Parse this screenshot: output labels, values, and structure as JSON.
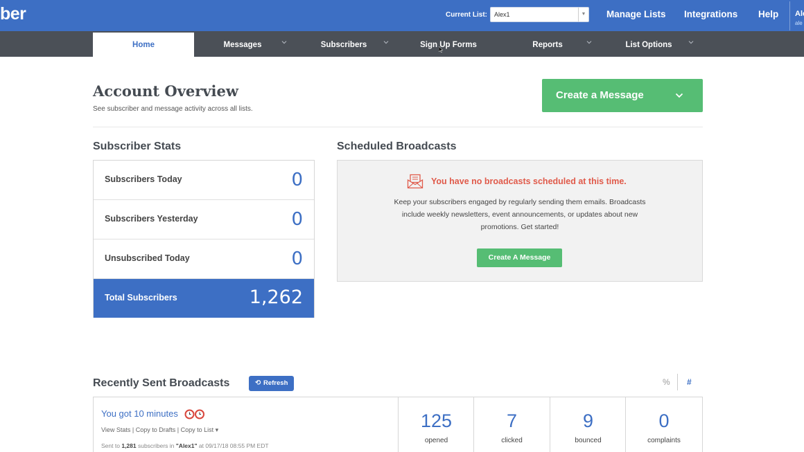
{
  "topbar": {
    "logo": "ber",
    "current_list_label": "Current List:",
    "current_list_value": "Alex1",
    "links": [
      "Manage Lists",
      "Integrations",
      "Help"
    ],
    "user_initial": "Ale",
    "user_sub": "ale"
  },
  "nav": {
    "items": [
      {
        "label": "Home",
        "active": true
      },
      {
        "label": "Messages"
      },
      {
        "label": "Subscribers"
      },
      {
        "label": "Sign Up Forms"
      },
      {
        "label": "Reports"
      },
      {
        "label": "List Options"
      }
    ]
  },
  "header": {
    "title": "Account Overview",
    "subtitle": "See subscriber and message activity across all lists.",
    "create_label": "Create a Message"
  },
  "subscriber_stats": {
    "heading": "Subscriber Stats",
    "rows": [
      {
        "label": "Subscribers Today",
        "value": "0"
      },
      {
        "label": "Subscribers Yesterday",
        "value": "0"
      },
      {
        "label": "Unsubscribed Today",
        "value": "0"
      },
      {
        "label": "Total Subscribers",
        "value": "1,262"
      }
    ]
  },
  "scheduled": {
    "heading": "Scheduled Broadcasts",
    "empty_title": "You have no broadcasts scheduled at this time.",
    "description": "Keep your subscribers engaged by regularly sending them emails. Broadcasts include weekly newsletters, event announcements, or updates about new promotions. Get started!",
    "button": "Create A Message"
  },
  "recent": {
    "heading": "Recently Sent Broadcasts",
    "refresh": "Refresh",
    "toggle_percent": "%",
    "toggle_count": "#",
    "broadcast": {
      "title": "You got 10 minutes",
      "view_stats": "View Stats",
      "copy_drafts": "Copy to Drafts",
      "copy_list": "Copy to List ▾",
      "sent_prefix": "Sent to",
      "sent_count": "1,281",
      "sent_mid": "subscribers in",
      "sent_list": "\"Alex1\"",
      "sent_suffix": "at 09/17/18 08:55 PM EDT",
      "metrics": [
        {
          "value": "125",
          "label": "opened"
        },
        {
          "value": "7",
          "label": "clicked"
        },
        {
          "value": "9",
          "label": "bounced"
        },
        {
          "value": "0",
          "label": "complaints"
        }
      ]
    }
  },
  "colors": {
    "brand_blue": "#3d6fc4",
    "nav_gray": "#4b5057",
    "green": "#56bd74",
    "alert_red": "#e05a4a"
  }
}
